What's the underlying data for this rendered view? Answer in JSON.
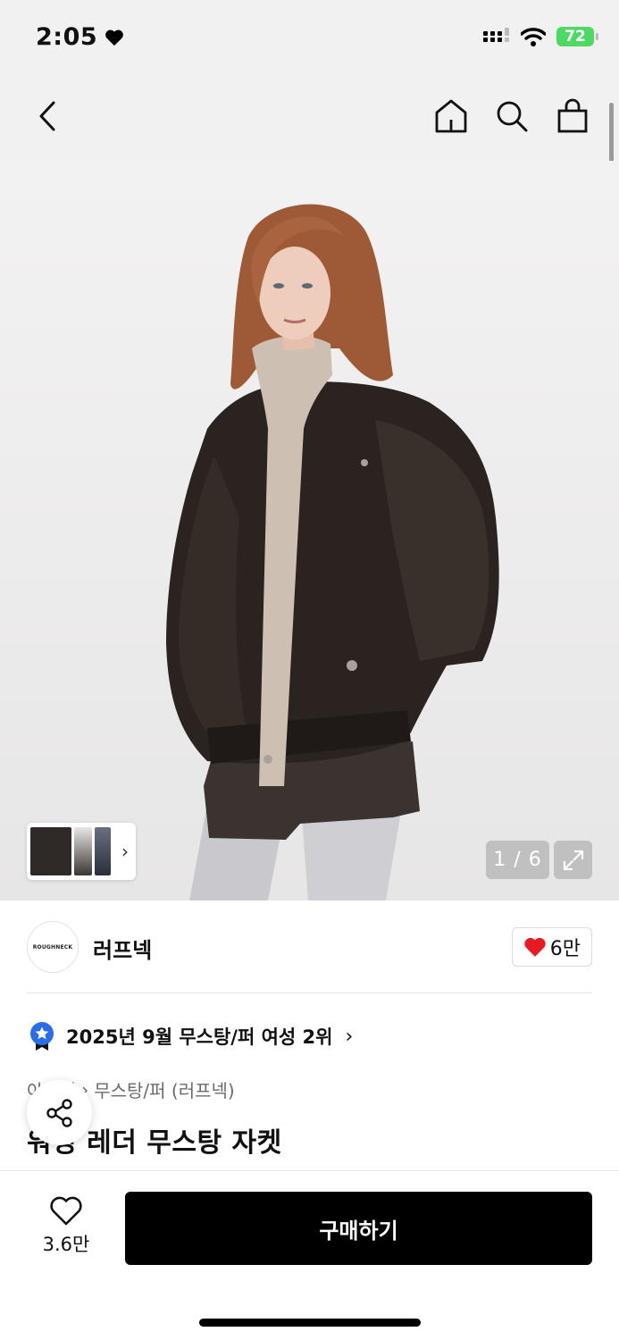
{
  "status_bar": {
    "time": "2:05",
    "battery": "72"
  },
  "nav": {
    "back_icon": "chevron-left-icon",
    "icons": [
      "home-icon",
      "search-icon",
      "shopping-bag-icon"
    ]
  },
  "gallery": {
    "page_counter": "1 / 6",
    "thumb_arrow": "›",
    "expand_icon": "expand-icon"
  },
  "brand": {
    "logo_text": "ROUGHNECK",
    "name": "러프넥",
    "like_count": "6만",
    "like_color": "#e8191f"
  },
  "ranking": {
    "text": "2025년 9월 무스탕/퍼 여성 2위",
    "chevron": "›",
    "badge_color": "#2a6de8"
  },
  "breadcrumb": {
    "items": [
      "아우터",
      "무스탕/퍼 (러프넥)"
    ],
    "separator": "›"
  },
  "product": {
    "title": "워싱 레더 무스탕 자켓"
  },
  "bottom_bar": {
    "wish_count": "3.6만",
    "buy_label": "구매하기"
  }
}
